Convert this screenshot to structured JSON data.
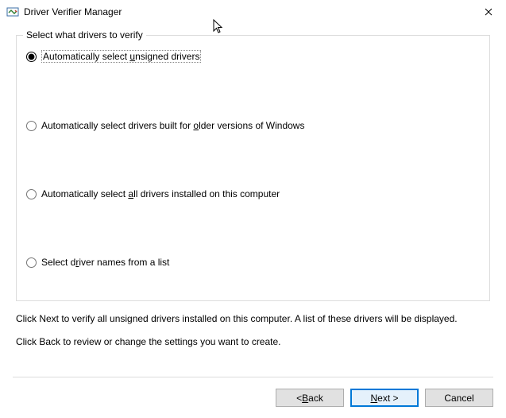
{
  "window": {
    "title": "Driver Verifier Manager"
  },
  "group": {
    "legend": "Select what drivers to verify",
    "options": [
      {
        "pre": "Automatically select ",
        "mn": "u",
        "post": "nsigned drivers",
        "selected": true
      },
      {
        "pre": "Automatically select drivers built for ",
        "mn": "o",
        "post": "lder versions of Windows",
        "selected": false
      },
      {
        "pre": "Automatically select ",
        "mn": "a",
        "post": "ll drivers installed on this computer",
        "selected": false
      },
      {
        "pre": "Select d",
        "mn": "r",
        "post": "iver names from a list",
        "selected": false
      }
    ]
  },
  "instructions": {
    "line1": "Click Next to verify all unsigned drivers installed on this computer. A list of these drivers will be displayed.",
    "line2": "Click Back to review or change the settings you want to create."
  },
  "buttons": {
    "back_pre": "< ",
    "back_mn": "B",
    "back_post": "ack",
    "next_pre": "",
    "next_mn": "N",
    "next_post": "ext >",
    "cancel": "Cancel"
  }
}
